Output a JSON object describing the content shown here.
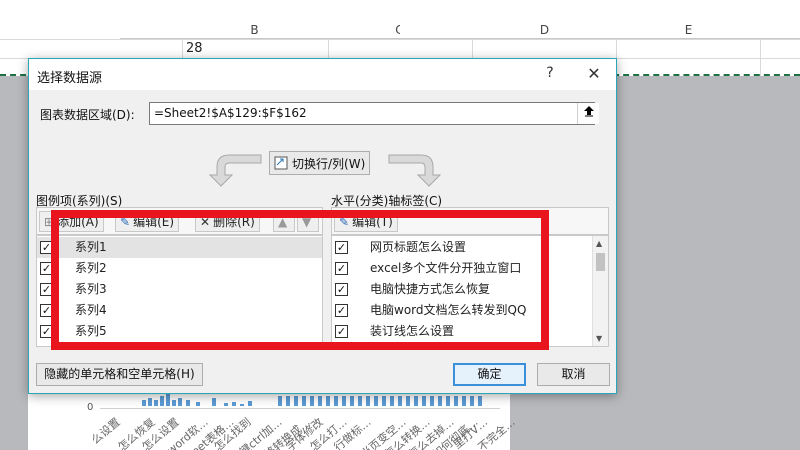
{
  "spreadsheet": {
    "columns": [
      "B",
      "C",
      "D",
      "E"
    ],
    "cell_value": "28",
    "chart": {
      "axis_zero": "0",
      "x_labels": [
        "么设置",
        "怎么恢复",
        "怎么设置",
        "word软…",
        "eet表格…",
        "怎么找到",
        "键ctrl加…",
        "格转换成…",
        "字体修改",
        "怎么打…",
        "行做标…",
        "当页变空…",
        "怎么转换…",
        "怎么去掉…",
        "如何彻底…",
        "里打V…",
        "不完全…"
      ]
    }
  },
  "dialog": {
    "title": "选择数据源",
    "help_label": "?",
    "close_label": "✕",
    "range_label": "图表数据区域(D):",
    "range_value": "=Sheet2!$A$129:$F$162",
    "switch_label": "切换行/列(W)",
    "series_section_label": "图例项(系列)(S)",
    "axis_section_label": "水平(分类)轴标签(C)",
    "series_toolbar": {
      "add_label": "添加(A)",
      "edit_label": "编辑(E)",
      "delete_label": "删除(R)"
    },
    "axis_toolbar": {
      "edit_label": "编辑(T)"
    },
    "series": [
      {
        "label": "系列1",
        "checked": true
      },
      {
        "label": "系列2",
        "checked": true
      },
      {
        "label": "系列3",
        "checked": true
      },
      {
        "label": "系列4",
        "checked": true
      },
      {
        "label": "系列5",
        "checked": true
      }
    ],
    "axis_labels": [
      {
        "label": "网页标题怎么设置",
        "checked": true
      },
      {
        "label": "excel多个文件分开独立窗口",
        "checked": true
      },
      {
        "label": "电脑快捷方式怎么恢复",
        "checked": true
      },
      {
        "label": "电脑word文档怎么转发到QQ",
        "checked": true
      },
      {
        "label": "装订线怎么设置",
        "checked": true
      }
    ],
    "hidden_cells_label": "隐藏的单元格和空单元格(H)",
    "ok_label": "确定",
    "cancel_label": "取消"
  },
  "colors": {
    "dialog_border": "#2aa6b8",
    "highlight_frame": "#e8141e",
    "sheet_dashed_border": "#1e7145",
    "chart_bar": "#5b9bd5"
  }
}
